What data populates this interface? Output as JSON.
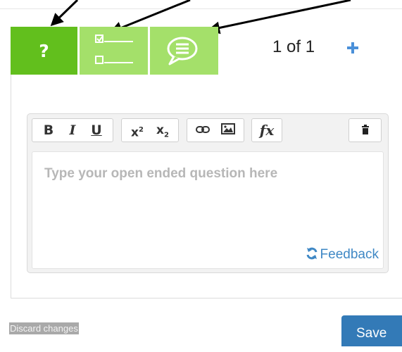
{
  "tabs": [
    {
      "id": "question",
      "glyph": "?",
      "icon": "question-icon",
      "active": true
    },
    {
      "id": "answers",
      "icon": "checklist-icon",
      "active": false
    },
    {
      "id": "feedback",
      "icon": "speech-bubble-icon",
      "active": false
    }
  ],
  "counter": {
    "current": "1",
    "of": "of",
    "total": "1"
  },
  "add_icon": "plus-icon",
  "toolbar": {
    "bold": "B",
    "italic": "I",
    "underline": "U",
    "superscript": "x",
    "superscript_mark": "2",
    "subscript": "x",
    "subscript_mark": "2",
    "formula": "fx",
    "groups_icons": [
      "link-icon",
      "image-icon",
      "formula-icon",
      "trash-icon"
    ]
  },
  "editor": {
    "placeholder": "Type your open ended question here"
  },
  "feedback_link": "Feedback",
  "footer": {
    "discard": "Discard changes",
    "save": "Save"
  },
  "colors": {
    "active_tab": "#62bf1d",
    "inactive_tab": "#a4e06a",
    "accent_blue": "#337ab7",
    "link_blue": "#3f88c5",
    "discard_bg": "#a9a9a9"
  }
}
